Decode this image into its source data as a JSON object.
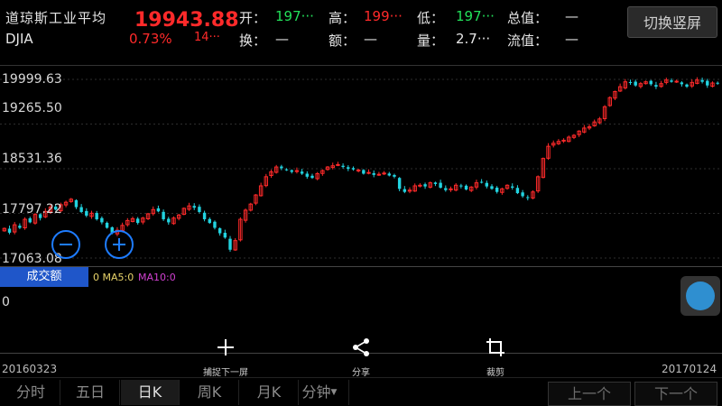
{
  "header": {
    "name": "道琼斯工业平均",
    "code": "DJIA",
    "price": "19943.88",
    "change_pct": "0.73%",
    "change_val": "14···",
    "open_label": "开：",
    "open_val": "197···",
    "high_label": "高：",
    "high_val": "199···",
    "low_label": "低：",
    "low_val": "197···",
    "total_label": "总值：",
    "total_val": "—",
    "turnover_label": "换：",
    "turnover_val": "—",
    "amount_label": "额：",
    "amount_val": "—",
    "volume_label": "量：",
    "volume_val": "2.7···",
    "float_label": "流值：",
    "float_val": "—",
    "switch_button": "切换竖屏"
  },
  "y_axis": {
    "labels": [
      "19999.63",
      "19265.50",
      "18531.36",
      "17797.22",
      "17063.08"
    ]
  },
  "volume_panel": {
    "tab_label": "成交额",
    "ma5": "0 MA5:0",
    "ma10": "MA10:0",
    "value": "0"
  },
  "tools": {
    "capture_next": "捕捉下一屏",
    "share": "分享",
    "crop": "裁剪"
  },
  "dates": {
    "start": "20160323",
    "end": "20170124"
  },
  "tabs": [
    "分时",
    "五日",
    "日K",
    "周K",
    "月K",
    "分钟"
  ],
  "nav": {
    "prev": "上一个",
    "next": "下一个"
  },
  "colors": {
    "up": "#ff2a2a",
    "down": "#22d3e0",
    "accent": "#1e7cff"
  },
  "chart_data": {
    "type": "candlestick",
    "x_start": "20160323",
    "x_end": "20170124",
    "ylim": [
      17063.08,
      19999.63
    ],
    "ticks": [
      19999.63,
      19265.5,
      18531.36,
      17797.22,
      17063.08
    ],
    "closes": [
      17550,
      17480,
      17610,
      17560,
      17700,
      17650,
      17780,
      17720,
      17830,
      17900,
      17860,
      17940,
      17980,
      18030,
      17900,
      17820,
      17760,
      17800,
      17700,
      17650,
      17560,
      17480,
      17520,
      17600,
      17680,
      17710,
      17640,
      17720,
      17790,
      17860,
      17830,
      17700,
      17650,
      17720,
      17770,
      17880,
      17920,
      17890,
      17820,
      17700,
      17640,
      17560,
      17470,
      17400,
      17200,
      17350,
      17700,
      17850,
      17950,
      18100,
      18250,
      18400,
      18480,
      18560,
      18540,
      18510,
      18480,
      18500,
      18450,
      18400,
      18380,
      18450,
      18500,
      18560,
      18580,
      18600,
      18560,
      18530,
      18520,
      18510,
      18450,
      18470,
      18430,
      18440,
      18460,
      18420,
      18400,
      18200,
      18150,
      18180,
      18250,
      18260,
      18240,
      18300,
      18280,
      18220,
      18180,
      18200,
      18260,
      18240,
      18190,
      18230,
      18300,
      18310,
      18240,
      18200,
      18150,
      18200,
      18260,
      18220,
      18130,
      18080,
      18050,
      18150,
      18400,
      18700,
      18900,
      18950,
      18980,
      19000,
      19050,
      19080,
      19150,
      19200,
      19220,
      19300,
      19350,
      19550,
      19700,
      19800,
      19880,
      19960,
      19950,
      19900,
      19930,
      19960,
      19920,
      19880,
      19930,
      19990,
      19960,
      19970,
      19920,
      19880,
      19950,
      19990,
      19960,
      19900,
      19940,
      19943.88
    ]
  }
}
